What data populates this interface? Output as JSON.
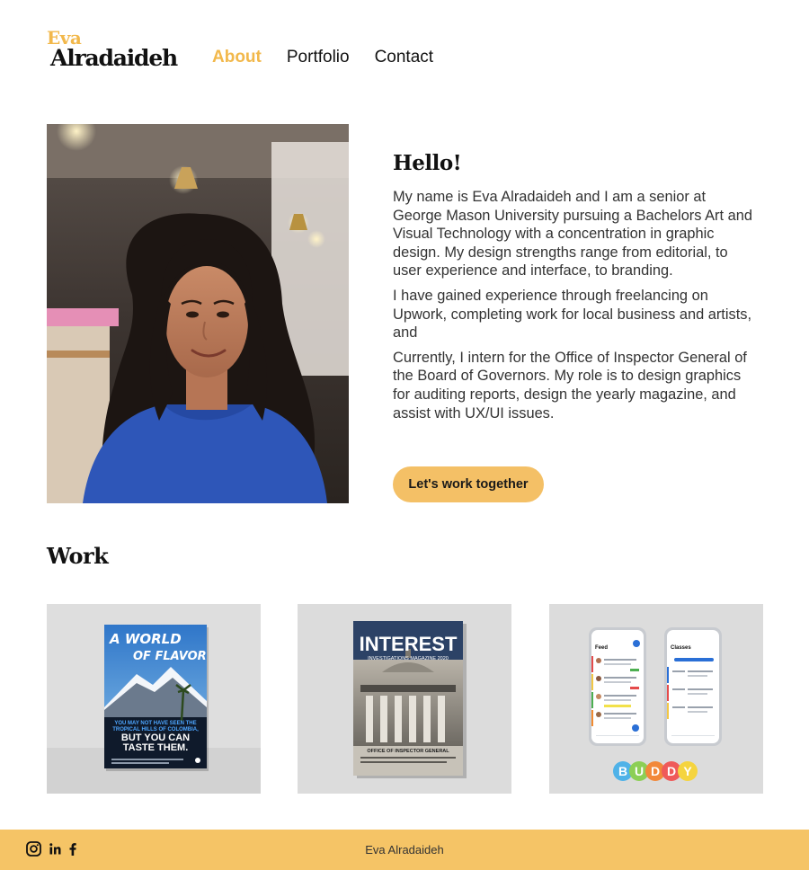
{
  "brand": {
    "first_name": "Eva",
    "last_name": "Alradaideh"
  },
  "nav": {
    "items": [
      {
        "label": "About",
        "active": true
      },
      {
        "label": "Portfolio",
        "active": false
      },
      {
        "label": "Contact",
        "active": false
      }
    ]
  },
  "intro": {
    "heading": "Hello!",
    "paragraphs": [
      "My name is Eva Alradaideh and I am a senior at George Mason University pursuing a Bachelors Art and Visual Technology with a concentration in graphic design. My design strengths range from editorial, to user experience and interface, to branding.",
      "I have gained experience through freelancing on Upwork, completing work for local business and artists, and",
      "Currently, I intern for the Office of Inspector General of the Board of Governors. My role is to design graphics for auditing reports, design the yearly magazine, and assist with UX/UI issues."
    ],
    "cta_label": "Let's work together"
  },
  "work": {
    "title": "Work",
    "cards": [
      {
        "kind": "poster",
        "title_line1": "A WORLD",
        "title_line2": "OF FLAVOR",
        "sub_line1": "YOU MAY NOT HAVE SEEN THE",
        "sub_line2": "TROPICAL HILLS OF COLOMBIA,",
        "big_line1": "BUT YOU CAN",
        "big_line2": "TASTE THEM."
      },
      {
        "kind": "magazine",
        "title": "INTEREST",
        "subtitle": "INVESTIGATIONS MAGAZINE 2020",
        "footer_line": "OFFICE OF INSPECTOR GENERAL"
      },
      {
        "kind": "app",
        "screen1_title": "Feed",
        "screen2_title": "Classes",
        "brand_letters": [
          "B",
          "U",
          "D",
          "D",
          "Y"
        ]
      }
    ]
  },
  "footer": {
    "copyright": "Eva Alradaideh",
    "social_icons": [
      "instagram-icon",
      "linkedin-icon",
      "facebook-icon"
    ]
  },
  "colors": {
    "accent": "#f2b84b",
    "footer_bg": "#f5c466",
    "button_bg": "#f4c066"
  }
}
